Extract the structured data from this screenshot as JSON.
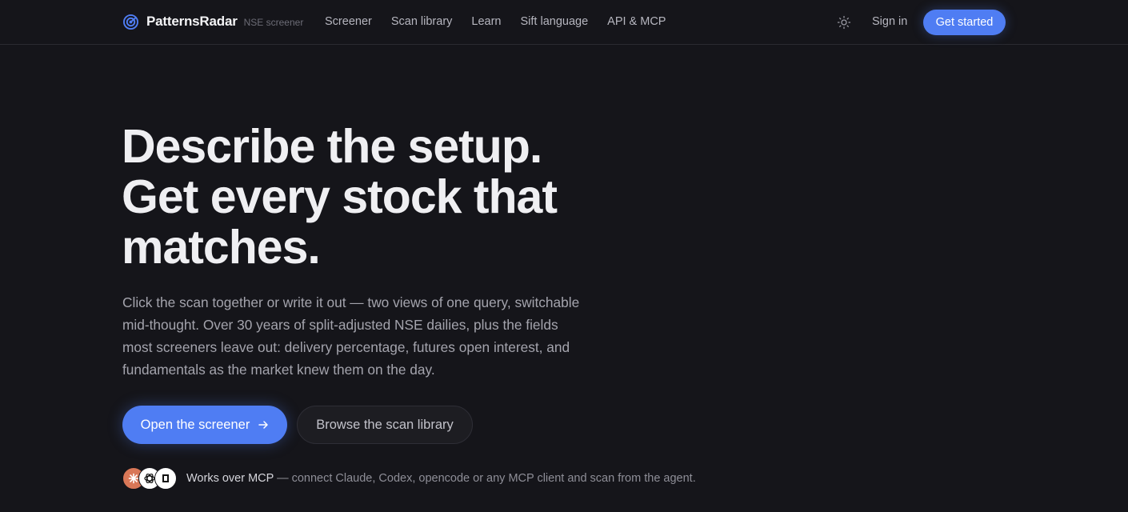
{
  "brand": {
    "name": "PatternsRadar",
    "tag": "NSE screener",
    "accent": "#4f7df3"
  },
  "nav": {
    "links": [
      "Screener",
      "Scan library",
      "Learn",
      "Sift language",
      "API & MCP"
    ],
    "theme_icon": "sun-icon",
    "sign_in": "Sign in",
    "get_started": "Get started"
  },
  "hero": {
    "headline_lines": [
      "Describe the setup.",
      "Get every stock that",
      "matches."
    ],
    "lede": "Click the scan together or write it out — two views of one query, switchable mid-thought. Over 30 years of split-adjusted NSE dailies, plus the fields most screeners leave out: delivery percentage, futures open interest, and fundamentals as the market knew them on the day.",
    "primary_cta": "Open the screener",
    "primary_cta_icon": "arrow-right-icon",
    "secondary_cta": "Browse the scan library"
  },
  "mcp": {
    "logos": [
      "claude-icon",
      "openai-icon",
      "opencode-icon"
    ],
    "strong": "Works over MCP",
    "rest": " — connect Claude, Codex, opencode or any MCP client and scan from the agent."
  }
}
